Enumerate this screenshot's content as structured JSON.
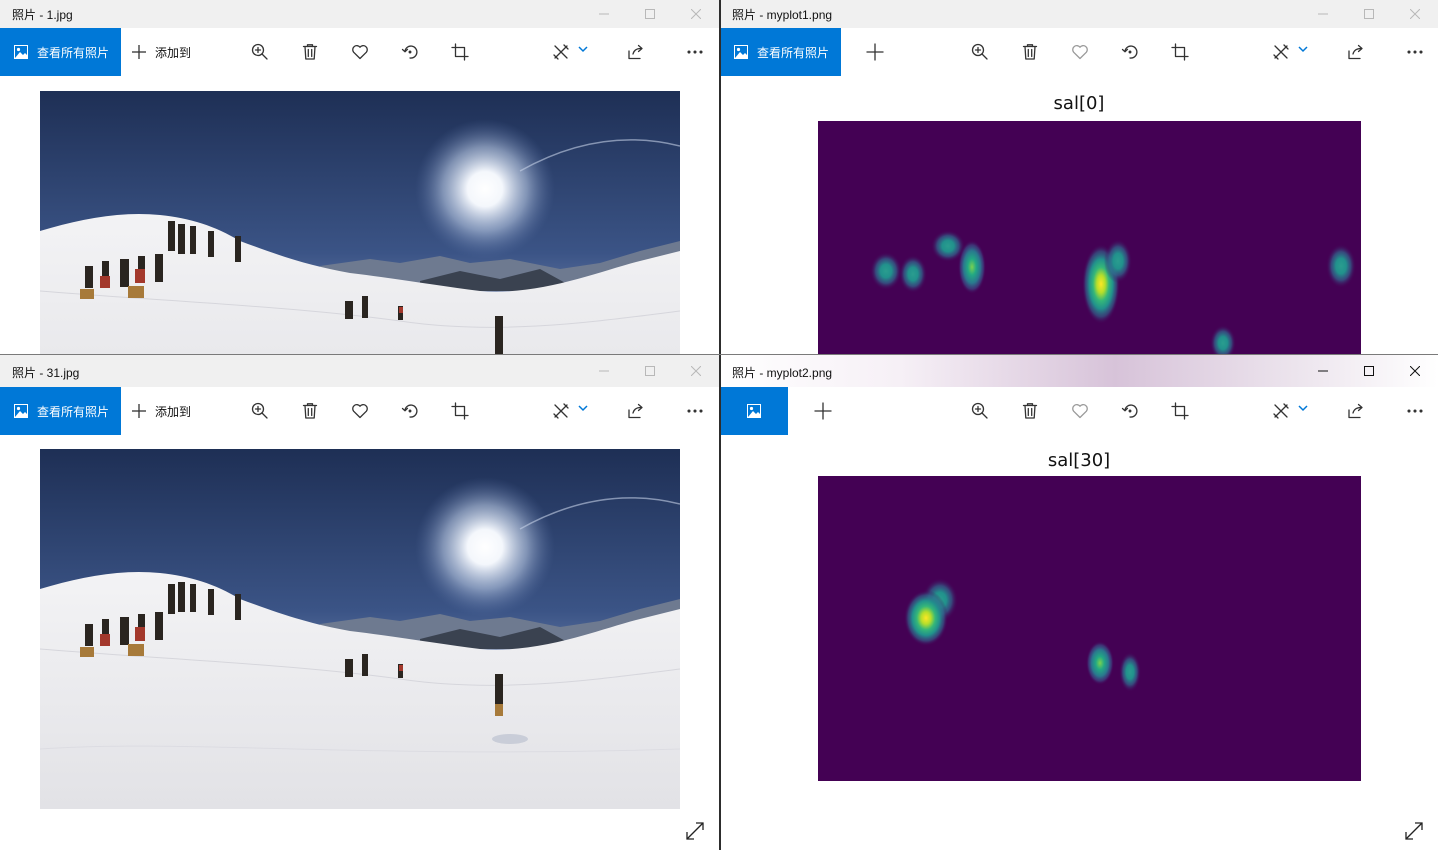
{
  "windows": {
    "top_left": {
      "title": "照片 - 1.jpg",
      "view_all_label": "查看所有照片",
      "add_label": "添加到"
    },
    "top_right": {
      "title": "照片 - myplot1.png",
      "view_all_label": "查看所有照片",
      "plot_title": "sal[0]"
    },
    "bottom_left": {
      "title": "照片 - 31.jpg",
      "view_all_label": "查看所有照片",
      "add_label": "添加到"
    },
    "bottom_right": {
      "title": "照片 - myplot2.png",
      "plot_title": "sal[30]"
    }
  },
  "colors": {
    "accent": "#0078d7",
    "heatmap_background": "#440154",
    "heatmap_mid": "#21918c",
    "heatmap_peak": "#fde725"
  },
  "toolbar_icons": [
    "view-all-photos-icon",
    "add-icon",
    "zoom-icon",
    "delete-icon",
    "favorite-icon",
    "rotate-icon",
    "crop-icon",
    "edit-create-icon",
    "share-icon",
    "more-icon"
  ]
}
